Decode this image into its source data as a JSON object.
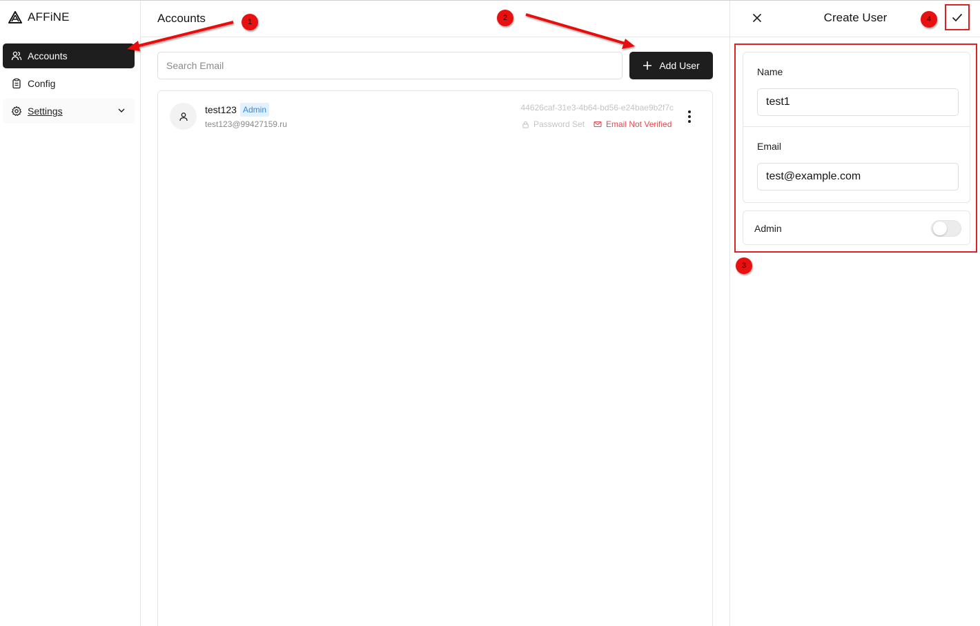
{
  "app": {
    "brand_name": "AFFiNE"
  },
  "sidebar": {
    "items": [
      {
        "label": "Accounts",
        "icon": "users-icon",
        "active": true
      },
      {
        "label": "Config",
        "icon": "clipboard-icon",
        "active": false
      },
      {
        "label": "Settings",
        "icon": "gear-icon",
        "active": false,
        "expandable": true
      }
    ]
  },
  "main": {
    "title": "Accounts",
    "search": {
      "placeholder": "Search Email",
      "value": ""
    },
    "add_user_label": "Add User",
    "users": [
      {
        "name": "test123",
        "badge": "Admin",
        "email": "test123@99427159.ru",
        "id": "44626caf-31e3-4b64-bd56-e24bae9b2f7c",
        "password_status": "Password Set",
        "email_status": "Email Not Verified"
      }
    ]
  },
  "panel": {
    "title": "Create User",
    "name_label": "Name",
    "name_value": "test1",
    "email_label": "Email",
    "email_value": "test@example.com",
    "admin_label": "Admin",
    "admin_enabled": false
  },
  "annotations": {
    "markers": [
      "1",
      "2",
      "3",
      "4"
    ],
    "color": "#e8110f"
  },
  "colors": {
    "active_nav": "#1e1e1e",
    "admin_badge_bg": "#e3f1ff",
    "admin_badge_text": "#2e8ae6",
    "error": "#e5484d"
  }
}
